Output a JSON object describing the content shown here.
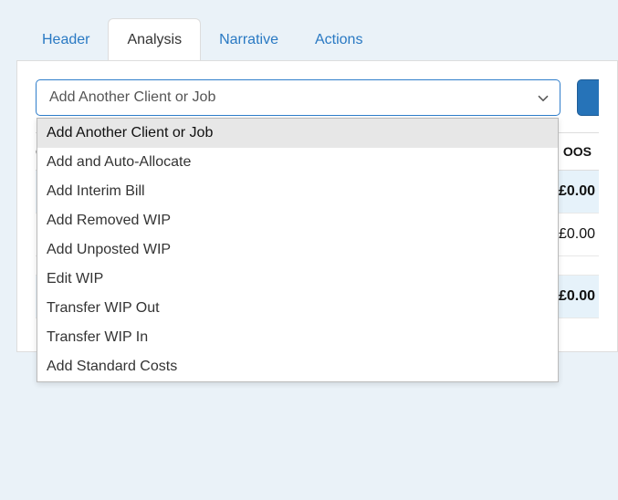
{
  "tabs": {
    "header": "Header",
    "analysis": "Analysis",
    "narrative": "Narrative",
    "actions": "Actions"
  },
  "select": {
    "current": "Add Another Client or Job",
    "options": [
      "Add Another Client or Job",
      "Add and Auto-Allocate",
      "Add Interim Bill",
      "Add Removed WIP",
      "Add Unposted WIP",
      "Edit WIP",
      "Transfer WIP Out",
      "Transfer WIP In",
      "Add Standard Costs"
    ]
  },
  "table": {
    "col1_head_fragment": "C",
    "col2_head": "OOS",
    "row1_left_fragment": "",
    "row1_right": "£0.00",
    "row2_left_fragment": "",
    "row2_right": "£0.00",
    "row4_right": "£0.00"
  }
}
